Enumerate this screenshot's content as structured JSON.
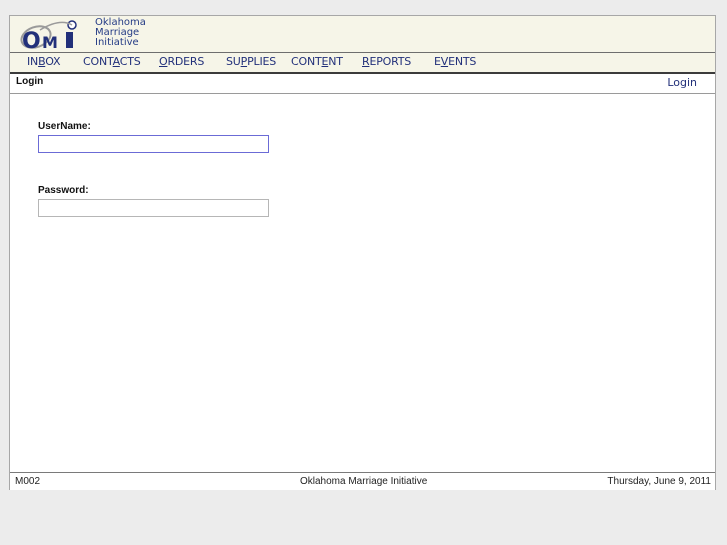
{
  "logo": {
    "line1": "Oklahoma",
    "line2": "Marriage",
    "line3": "Initiative"
  },
  "menu": [
    {
      "pre": "IN",
      "key": "B",
      "post": "OX"
    },
    {
      "pre": "CONT",
      "key": "A",
      "post": "CTS"
    },
    {
      "pre": "",
      "key": "O",
      "post": "RDERS"
    },
    {
      "pre": "SU",
      "key": "P",
      "post": "PLIES"
    },
    {
      "pre": "CONT",
      "key": "E",
      "post": "NT"
    },
    {
      "pre": "",
      "key": "R",
      "post": "EPORTS"
    },
    {
      "pre": "E",
      "key": "V",
      "post": "ENTS"
    }
  ],
  "page": {
    "title": "Login",
    "action_link": "Login"
  },
  "form": {
    "username_label": "UserName:",
    "username_value": "",
    "password_label": "Password:",
    "password_value": ""
  },
  "status": {
    "code": "M002",
    "org": "Oklahoma Marriage Initiative",
    "date": "Thursday, June 9, 2011"
  },
  "colors": {
    "brand_blue": "#22307a",
    "banner_bg": "#f6f5e8",
    "focus_border": "#6b6bd6"
  }
}
